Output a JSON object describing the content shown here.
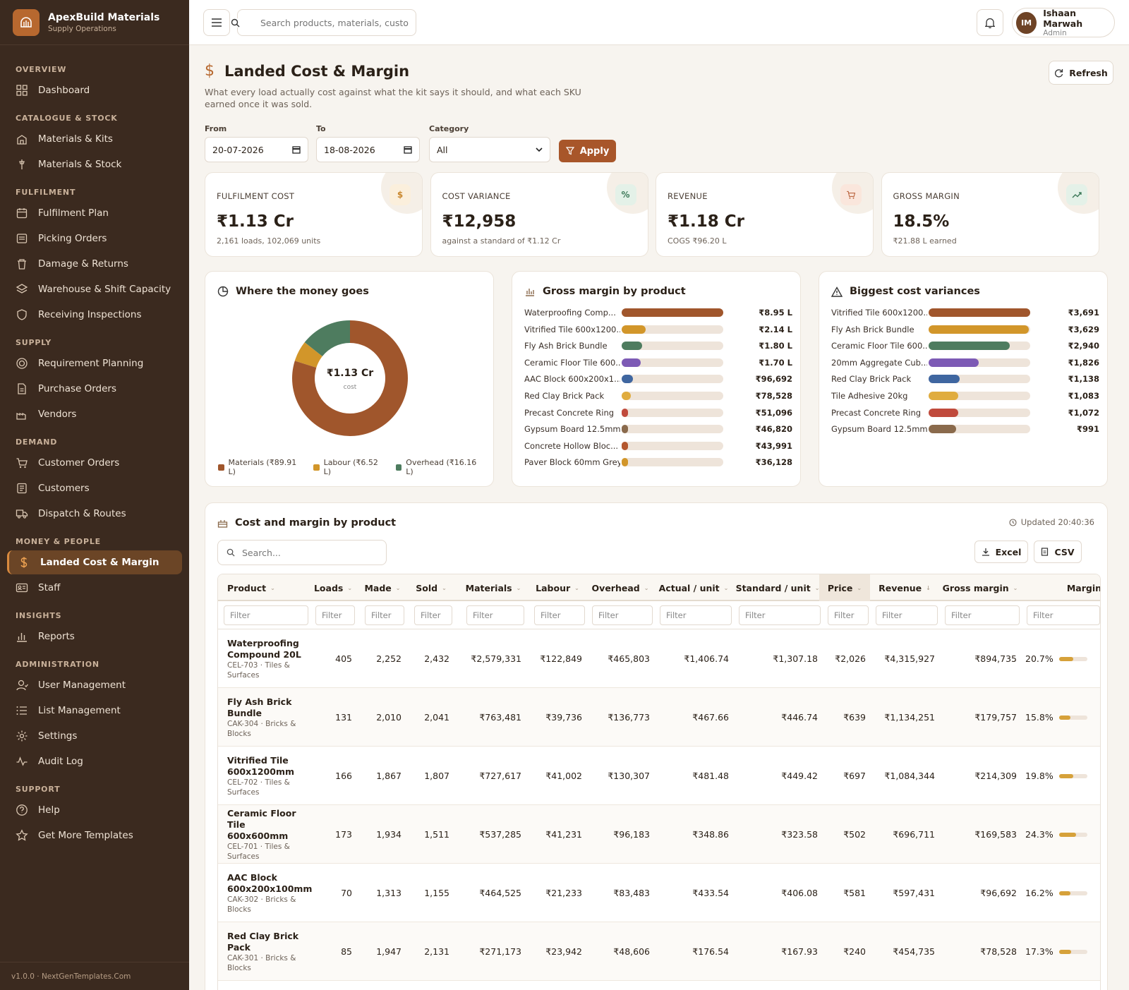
{
  "brand": {
    "name": "ApexBuild Materials",
    "sub": "Supply Operations"
  },
  "nav": [
    {
      "section": "OVERVIEW",
      "items": [
        {
          "label": "Dashboard",
          "icon": "dashboard-icon"
        }
      ]
    },
    {
      "section": "CATALOGUE & STOCK",
      "items": [
        {
          "label": "Materials & Kits",
          "icon": "kits-icon"
        },
        {
          "label": "Materials & Stock",
          "icon": "stock-icon"
        }
      ]
    },
    {
      "section": "FULFILMENT",
      "items": [
        {
          "label": "Fulfilment Plan",
          "icon": "calendar-icon"
        },
        {
          "label": "Picking Orders",
          "icon": "picking-icon"
        },
        {
          "label": "Damage & Returns",
          "icon": "trash-icon"
        },
        {
          "label": "Warehouse & Shift Capacity",
          "icon": "layers-icon"
        },
        {
          "label": "Receiving Inspections",
          "icon": "shield-icon"
        }
      ]
    },
    {
      "section": "SUPPLY",
      "items": [
        {
          "label": "Requirement Planning",
          "icon": "target-icon"
        },
        {
          "label": "Purchase Orders",
          "icon": "document-icon"
        },
        {
          "label": "Vendors",
          "icon": "factory-icon"
        }
      ]
    },
    {
      "section": "DEMAND",
      "items": [
        {
          "label": "Customer Orders",
          "icon": "cart-icon"
        },
        {
          "label": "Customers",
          "icon": "customers-icon"
        },
        {
          "label": "Dispatch & Routes",
          "icon": "truck-icon"
        }
      ]
    },
    {
      "section": "MONEY & PEOPLE",
      "items": [
        {
          "label": "Landed Cost & Margin",
          "icon": "dollar-icon",
          "active": true
        },
        {
          "label": "Staff",
          "icon": "id-card-icon"
        }
      ]
    },
    {
      "section": "INSIGHTS",
      "items": [
        {
          "label": "Reports",
          "icon": "bar-chart-icon"
        }
      ]
    },
    {
      "section": "ADMINISTRATION",
      "items": [
        {
          "label": "User Management",
          "icon": "user-icon"
        },
        {
          "label": "List Management",
          "icon": "list-icon"
        },
        {
          "label": "Settings",
          "icon": "gear-icon"
        },
        {
          "label": "Audit Log",
          "icon": "activity-icon"
        }
      ]
    },
    {
      "section": "SUPPORT",
      "items": [
        {
          "label": "Help",
          "icon": "help-icon"
        },
        {
          "label": "Get More Templates",
          "icon": "star-icon"
        }
      ]
    }
  ],
  "footer": "v1.0.0 · NextGenTemplates.Com",
  "topbar": {
    "search_placeholder": "Search products, materials, customers...",
    "user_initials": "IM",
    "user_name": "Ishaan Marwah",
    "user_role": "Admin"
  },
  "page": {
    "title": "Landed Cost & Margin",
    "description": "What every load actually cost against what the kit says it should, and what each SKU earned once it was sold.",
    "refresh_label": "Refresh",
    "filters": {
      "from_label": "From",
      "from_value": "20-07-2026",
      "to_label": "To",
      "to_value": "18-08-2026",
      "category_label": "Category",
      "category_value": "All",
      "apply_label": "Apply"
    }
  },
  "kpis": [
    {
      "label": "FULFILMENT COST",
      "value": "₹1.13 Cr",
      "sub": "2,161 loads, 102,069 units",
      "icon": "$",
      "icon_color": "#c9872e",
      "icon_bg": "#fbefdc"
    },
    {
      "label": "COST VARIANCE",
      "value": "₹12,958",
      "sub": "against a standard of ₹1.12 Cr",
      "icon": "%",
      "icon_color": "#3f7a5a",
      "icon_bg": "#e4f1e8"
    },
    {
      "label": "REVENUE",
      "value": "₹1.18 Cr",
      "sub": "COGS ₹96.20 L",
      "icon": "cart",
      "icon_color": "#b4572e",
      "icon_bg": "#fae6dc"
    },
    {
      "label": "GROSS MARGIN",
      "value": "18.5%",
      "sub": "₹21.88 L earned",
      "icon": "trend",
      "icon_color": "#3f7a5a",
      "icon_bg": "#e4f1e8"
    }
  ],
  "donut": {
    "title": "Where the money goes",
    "center_value": "₹1.13 Cr",
    "center_label": "cost",
    "segments": [
      {
        "label": "Materials (₹89.91 L)",
        "value": 89.91,
        "color": "#a0562c"
      },
      {
        "label": "Labour (₹6.52 L)",
        "value": 6.52,
        "color": "#d2962a"
      },
      {
        "label": "Overhead (₹16.16 L)",
        "value": 16.16,
        "color": "#4e7c5f"
      }
    ]
  },
  "margin_chart": {
    "title": "Gross margin by product",
    "max": 895000,
    "rows": [
      {
        "label": "Waterproofing Comp...",
        "value": 894735,
        "display": "₹8.95 L",
        "color": "#a0562c"
      },
      {
        "label": "Vitrified Tile 600x1200...",
        "value": 214309,
        "display": "₹2.14 L",
        "color": "#d2962a"
      },
      {
        "label": "Fly Ash Brick Bundle",
        "value": 179757,
        "display": "₹1.80 L",
        "color": "#4e7c5f"
      },
      {
        "label": "Ceramic Floor Tile 600...",
        "value": 169583,
        "display": "₹1.70 L",
        "color": "#7d5ab5"
      },
      {
        "label": "AAC Block 600x200x1...",
        "value": 96692,
        "display": "₹96,692",
        "color": "#3f66a0"
      },
      {
        "label": "Red Clay Brick Pack",
        "value": 78528,
        "display": "₹78,528",
        "color": "#e0ac3e"
      },
      {
        "label": "Precast Concrete Ring",
        "value": 51096,
        "display": "₹51,096",
        "color": "#c04a3c"
      },
      {
        "label": "Gypsum Board 12.5mm",
        "value": 46820,
        "display": "₹46,820",
        "color": "#8a6a4c"
      },
      {
        "label": "Concrete Hollow Bloc...",
        "value": 43991,
        "display": "₹43,991",
        "color": "#b4572e"
      },
      {
        "label": "Paver Block 60mm Grey",
        "value": 36128,
        "display": "₹36,128",
        "color": "#d2962a"
      }
    ]
  },
  "variance_chart": {
    "title": "Biggest cost variances",
    "max": 3691,
    "rows": [
      {
        "label": "Vitrified Tile 600x1200...",
        "value": 3691,
        "display": "₹3,691",
        "color": "#a0562c"
      },
      {
        "label": "Fly Ash Brick Bundle",
        "value": 3629,
        "display": "₹3,629",
        "color": "#d2962a"
      },
      {
        "label": "Ceramic Floor Tile 600...",
        "value": 2940,
        "display": "₹2,940",
        "color": "#4e7c5f"
      },
      {
        "label": "20mm Aggregate Cub...",
        "value": 1826,
        "display": "₹1,826",
        "color": "#7d5ab5"
      },
      {
        "label": "Red Clay Brick Pack",
        "value": 1138,
        "display": "₹1,138",
        "color": "#3f66a0"
      },
      {
        "label": "Tile Adhesive 20kg",
        "value": 1083,
        "display": "₹1,083",
        "color": "#e0ac3e"
      },
      {
        "label": "Precast Concrete Ring",
        "value": 1072,
        "display": "₹1,072",
        "color": "#c04a3c"
      },
      {
        "label": "Gypsum Board 12.5mm",
        "value": 991,
        "display": "₹991",
        "color": "#8a6a4c"
      }
    ]
  },
  "table": {
    "title": "Cost and margin by product",
    "updated": "Updated 20:40:36",
    "search_placeholder": "Search...",
    "excel_label": "Excel",
    "csv_label": "CSV",
    "filter_placeholder": "Filter",
    "columns": [
      "Product",
      "Loads",
      "Made",
      "Sold",
      "Materials",
      "Labour",
      "Overhead",
      "Actual / unit",
      "Standard / unit",
      "Price",
      "Revenue",
      "Gross margin",
      "Margin"
    ],
    "rows": [
      {
        "name": "Waterproofing Compound 20L",
        "sub": "CEL-703 · Tiles & Surfaces",
        "loads": "405",
        "made": "2,252",
        "sold": "2,432",
        "materials": "₹2,579,331",
        "labour": "₹122,849",
        "overhead": "₹465,803",
        "actual": "₹1,406.74",
        "standard": "₹1,307.18",
        "price": "₹2,026",
        "revenue": "₹4,315,927",
        "gross": "₹894,735",
        "margin": "20.7%",
        "margin_pct": 20.7
      },
      {
        "name": "Fly Ash Brick Bundle",
        "sub": "CAK-304 · Bricks & Blocks",
        "loads": "131",
        "made": "2,010",
        "sold": "2,041",
        "materials": "₹763,481",
        "labour": "₹39,736",
        "overhead": "₹136,773",
        "actual": "₹467.66",
        "standard": "₹446.74",
        "price": "₹639",
        "revenue": "₹1,134,251",
        "gross": "₹179,757",
        "margin": "15.8%",
        "margin_pct": 15.8
      },
      {
        "name": "Vitrified Tile 600x1200mm",
        "sub": "CEL-702 · Tiles & Surfaces",
        "loads": "166",
        "made": "1,867",
        "sold": "1,807",
        "materials": "₹727,617",
        "labour": "₹41,002",
        "overhead": "₹130,307",
        "actual": "₹481.48",
        "standard": "₹449.42",
        "price": "₹697",
        "revenue": "₹1,084,344",
        "gross": "₹214,309",
        "margin": "19.8%",
        "margin_pct": 19.8
      },
      {
        "name": "Ceramic Floor Tile 600x600mm",
        "sub": "CEL-701 · Tiles & Surfaces",
        "loads": "173",
        "made": "1,934",
        "sold": "1,511",
        "materials": "₹537,285",
        "labour": "₹41,231",
        "overhead": "₹96,183",
        "actual": "₹348.86",
        "standard": "₹323.58",
        "price": "₹502",
        "revenue": "₹696,711",
        "gross": "₹169,583",
        "margin": "24.3%",
        "margin_pct": 24.3
      },
      {
        "name": "AAC Block 600x200x100mm",
        "sub": "CAK-302 · Bricks & Blocks",
        "loads": "70",
        "made": "1,313",
        "sold": "1,155",
        "materials": "₹464,525",
        "labour": "₹21,233",
        "overhead": "₹83,483",
        "actual": "₹433.54",
        "standard": "₹406.08",
        "price": "₹581",
        "revenue": "₹597,431",
        "gross": "₹96,692",
        "margin": "16.2%",
        "margin_pct": 16.2
      },
      {
        "name": "Red Clay Brick Pack",
        "sub": "CAK-301 · Bricks & Blocks",
        "loads": "85",
        "made": "1,947",
        "sold": "2,131",
        "materials": "₹271,173",
        "labour": "₹23,942",
        "overhead": "₹48,606",
        "actual": "₹176.54",
        "standard": "₹167.93",
        "price": "₹240",
        "revenue": "₹454,735",
        "gross": "₹78,528",
        "margin": "17.3%",
        "margin_pct": 17.3
      }
    ]
  }
}
